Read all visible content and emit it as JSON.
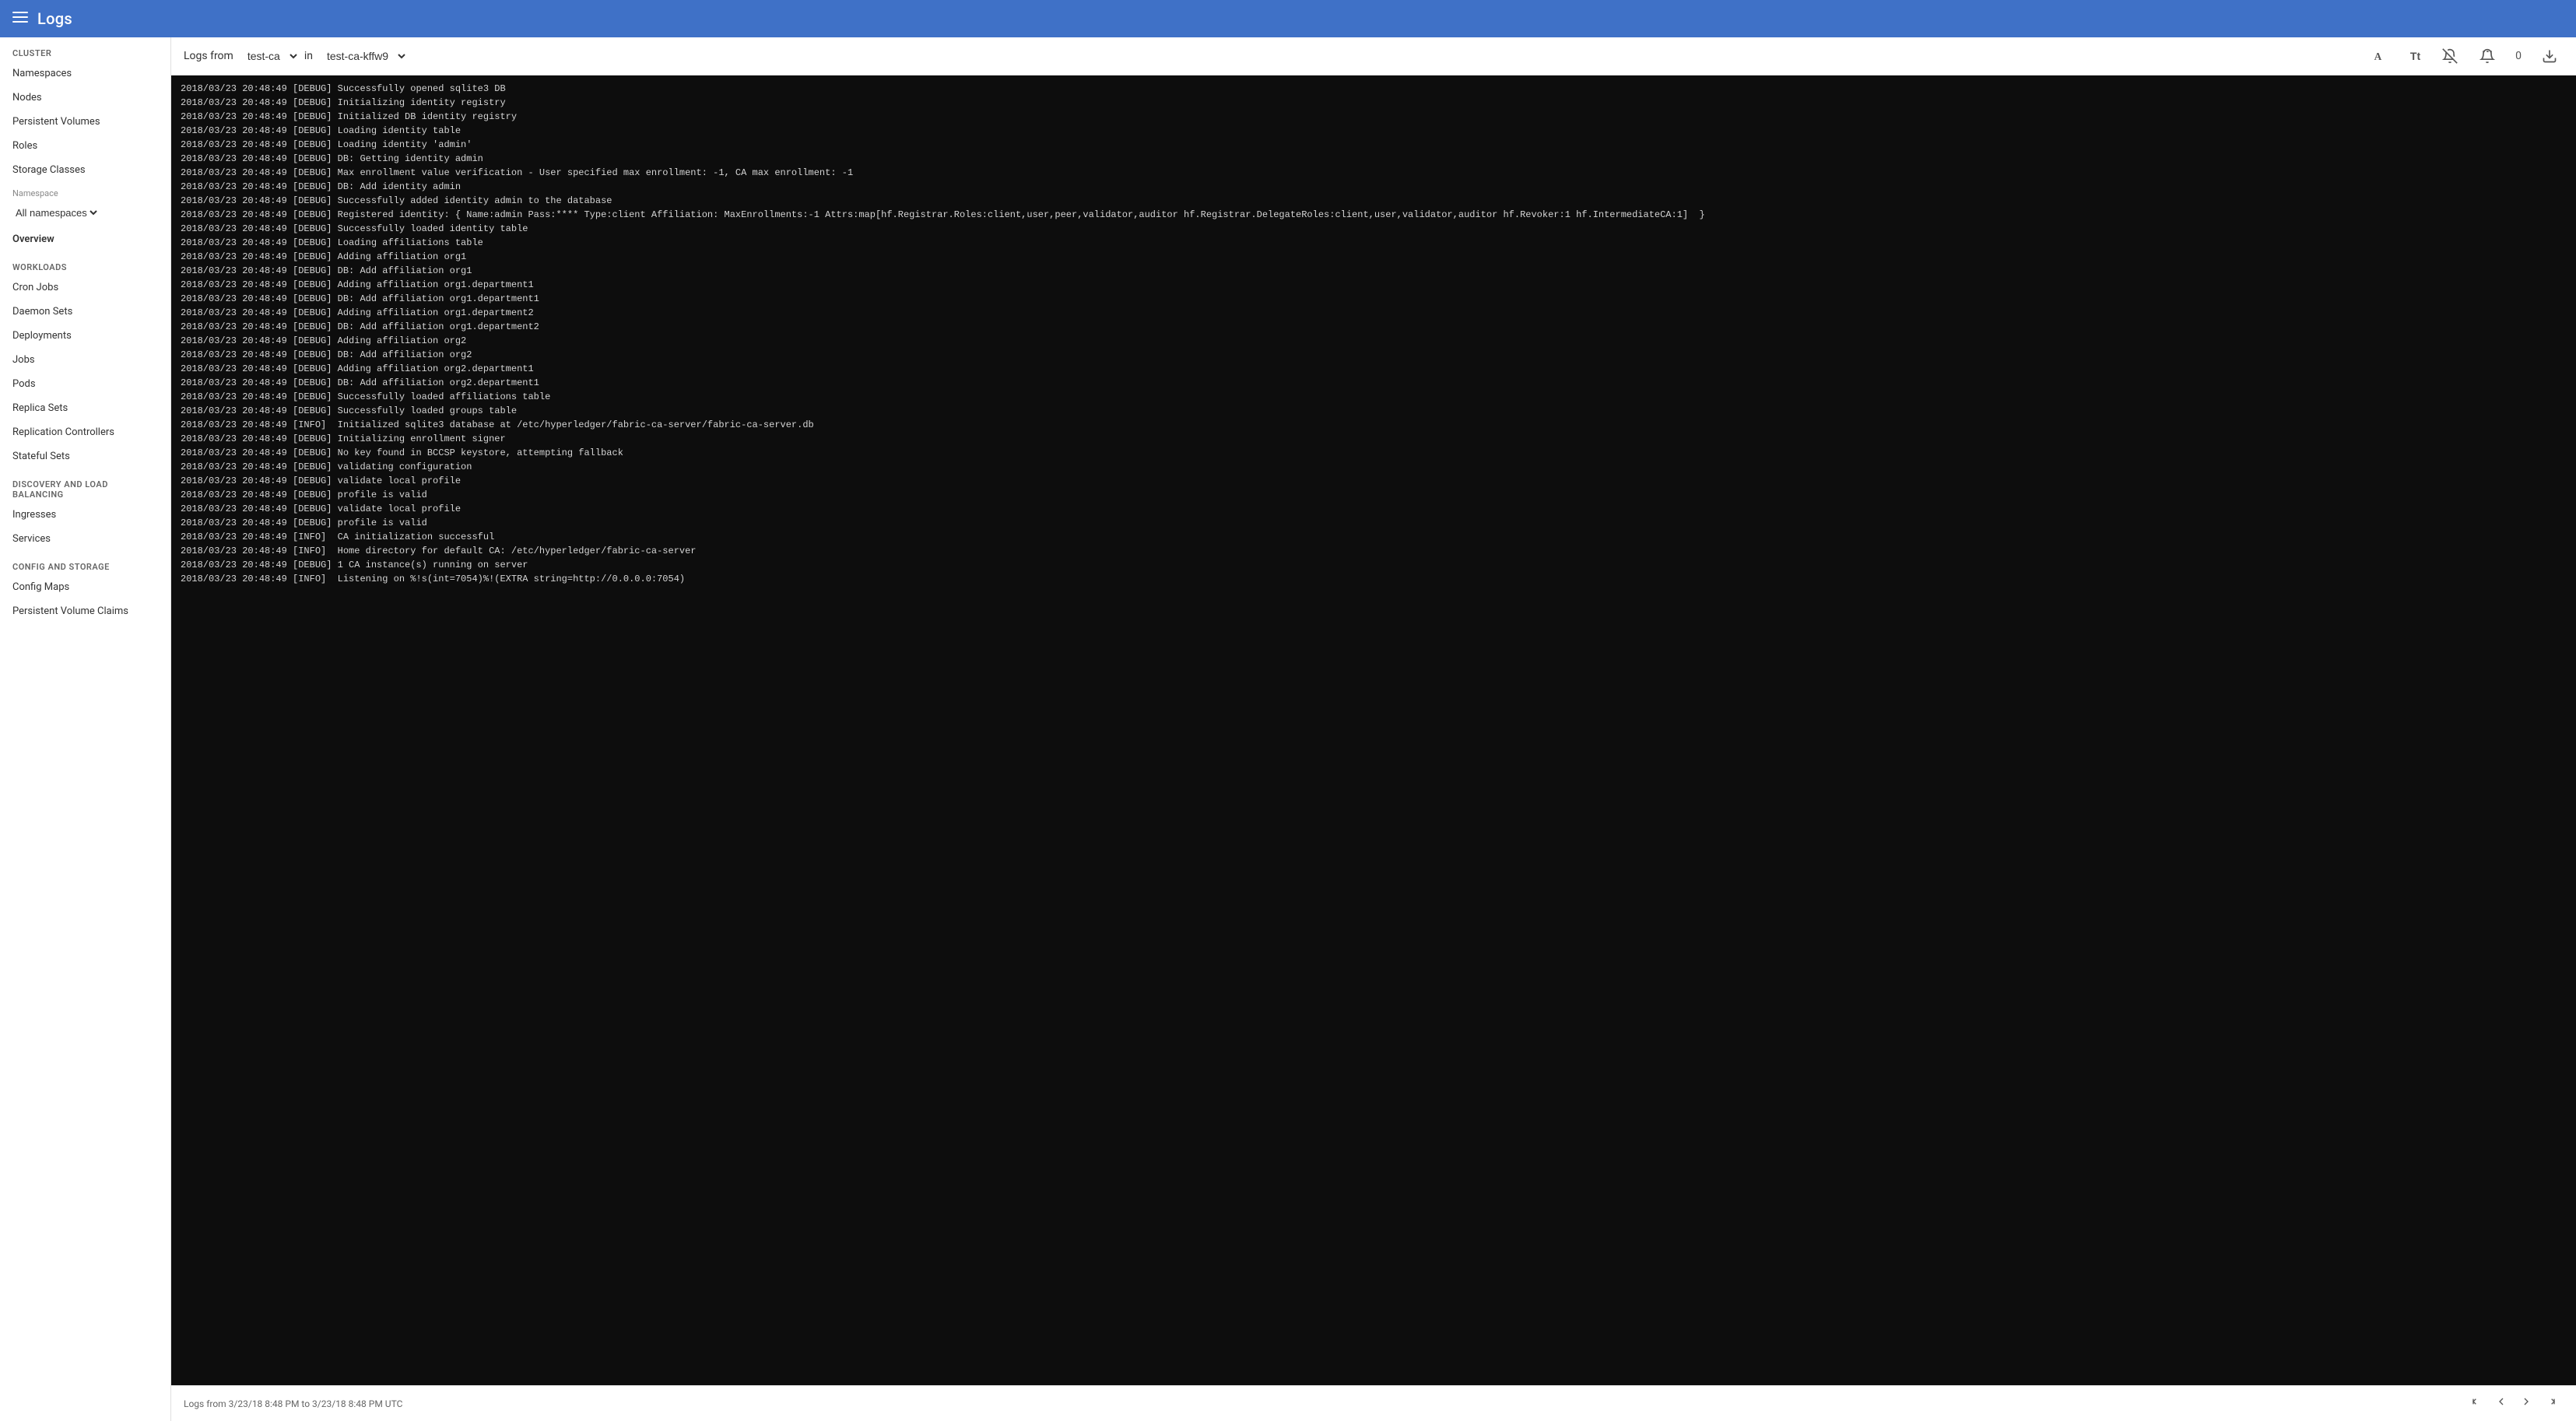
{
  "topbar": {
    "title": "Logs",
    "hamburger_icon": "☰"
  },
  "sidebar": {
    "cluster_section": "Cluster",
    "cluster_items": [
      {
        "label": "Namespaces",
        "id": "namespaces"
      },
      {
        "label": "Nodes",
        "id": "nodes"
      },
      {
        "label": "Persistent Volumes",
        "id": "persistent-volumes"
      },
      {
        "label": "Roles",
        "id": "roles"
      },
      {
        "label": "Storage Classes",
        "id": "storage-classes"
      }
    ],
    "namespace_label": "Namespace",
    "namespace_value": "All namespaces",
    "overview_label": "Overview",
    "workloads_section": "Workloads",
    "workload_items": [
      {
        "label": "Cron Jobs",
        "id": "cron-jobs"
      },
      {
        "label": "Daemon Sets",
        "id": "daemon-sets"
      },
      {
        "label": "Deployments",
        "id": "deployments"
      },
      {
        "label": "Jobs",
        "id": "jobs"
      },
      {
        "label": "Pods",
        "id": "pods"
      },
      {
        "label": "Replica Sets",
        "id": "replica-sets"
      },
      {
        "label": "Replication Controllers",
        "id": "replication-controllers"
      },
      {
        "label": "Stateful Sets",
        "id": "stateful-sets"
      }
    ],
    "discovery_section": "Discovery and Load Balancing",
    "discovery_items": [
      {
        "label": "Ingresses",
        "id": "ingresses"
      },
      {
        "label": "Services",
        "id": "services"
      }
    ],
    "config_section": "Config and Storage",
    "config_items": [
      {
        "label": "Config Maps",
        "id": "config-maps"
      },
      {
        "label": "Persistent Volume Claims",
        "id": "pvc"
      }
    ]
  },
  "logs_toolbar": {
    "logs_from_label": "Logs from test-ca",
    "in_label": "in test-ca-kffw9",
    "count": "0",
    "download_icon": "⬇",
    "font_icon": "A",
    "text_icon": "Tt",
    "bell_off_icon": "🔕",
    "bell_icon": "🔔"
  },
  "logs_footer": {
    "range_text": "Logs from 3/23/18 8:48 PM to 3/23/18 8:48 PM UTC",
    "first_icon": "|◀",
    "prev_icon": "◀",
    "next_icon": "▶",
    "last_icon": "▶|"
  },
  "log_lines": [
    "2018/03/23 20:48:49 [DEBUG] Successfully opened sqlite3 DB",
    "2018/03/23 20:48:49 [DEBUG] Initializing identity registry",
    "2018/03/23 20:48:49 [DEBUG] Initialized DB identity registry",
    "2018/03/23 20:48:49 [DEBUG] Loading identity table",
    "2018/03/23 20:48:49 [DEBUG] Loading identity 'admin'",
    "2018/03/23 20:48:49 [DEBUG] DB: Getting identity admin",
    "2018/03/23 20:48:49 [DEBUG] Max enrollment value verification - User specified max enrollment: -1, CA max enrollment: -1",
    "2018/03/23 20:48:49 [DEBUG] DB: Add identity admin",
    "2018/03/23 20:48:49 [DEBUG] Successfully added identity admin to the database",
    "2018/03/23 20:48:49 [DEBUG] Registered identity: { Name:admin Pass:**** Type:client Affiliation: MaxEnrollments:-1 Attrs:map[hf.Registrar.Roles:client,user,peer,validator,auditor hf.Registrar.DelegateRoles:client,user,validator,auditor hf.Revoker:1 hf.IntermediateCA:1]  }",
    "2018/03/23 20:48:49 [DEBUG] Successfully loaded identity table",
    "2018/03/23 20:48:49 [DEBUG] Loading affiliations table",
    "2018/03/23 20:48:49 [DEBUG] Adding affiliation org1",
    "2018/03/23 20:48:49 [DEBUG] DB: Add affiliation org1",
    "2018/03/23 20:48:49 [DEBUG] Adding affiliation org1.department1",
    "2018/03/23 20:48:49 [DEBUG] DB: Add affiliation org1.department1",
    "2018/03/23 20:48:49 [DEBUG] Adding affiliation org1.department2",
    "2018/03/23 20:48:49 [DEBUG] DB: Add affiliation org1.department2",
    "2018/03/23 20:48:49 [DEBUG] Adding affiliation org2",
    "2018/03/23 20:48:49 [DEBUG] DB: Add affiliation org2",
    "2018/03/23 20:48:49 [DEBUG] Adding affiliation org2.department1",
    "2018/03/23 20:48:49 [DEBUG] DB: Add affiliation org2.department1",
    "2018/03/23 20:48:49 [DEBUG] Successfully loaded affiliations table",
    "2018/03/23 20:48:49 [DEBUG] Successfully loaded groups table",
    "2018/03/23 20:48:49 [INFO]  Initialized sqlite3 database at /etc/hyperledger/fabric-ca-server/fabric-ca-server.db",
    "2018/03/23 20:48:49 [DEBUG] Initializing enrollment signer",
    "2018/03/23 20:48:49 [DEBUG] No key found in BCCSP keystore, attempting fallback",
    "2018/03/23 20:48:49 [DEBUG] validating configuration",
    "2018/03/23 20:48:49 [DEBUG] validate local profile",
    "2018/03/23 20:48:49 [DEBUG] profile is valid",
    "2018/03/23 20:48:49 [DEBUG] validate local profile",
    "2018/03/23 20:48:49 [DEBUG] profile is valid",
    "2018/03/23 20:48:49 [INFO]  CA initialization successful",
    "2018/03/23 20:48:49 [INFO]  Home directory for default CA: /etc/hyperledger/fabric-ca-server",
    "2018/03/23 20:48:49 [DEBUG] 1 CA instance(s) running on server",
    "2018/03/23 20:48:49 [INFO]  Listening on %!s(int=7054)%!(EXTRA string=http://0.0.0.0:7054)"
  ]
}
